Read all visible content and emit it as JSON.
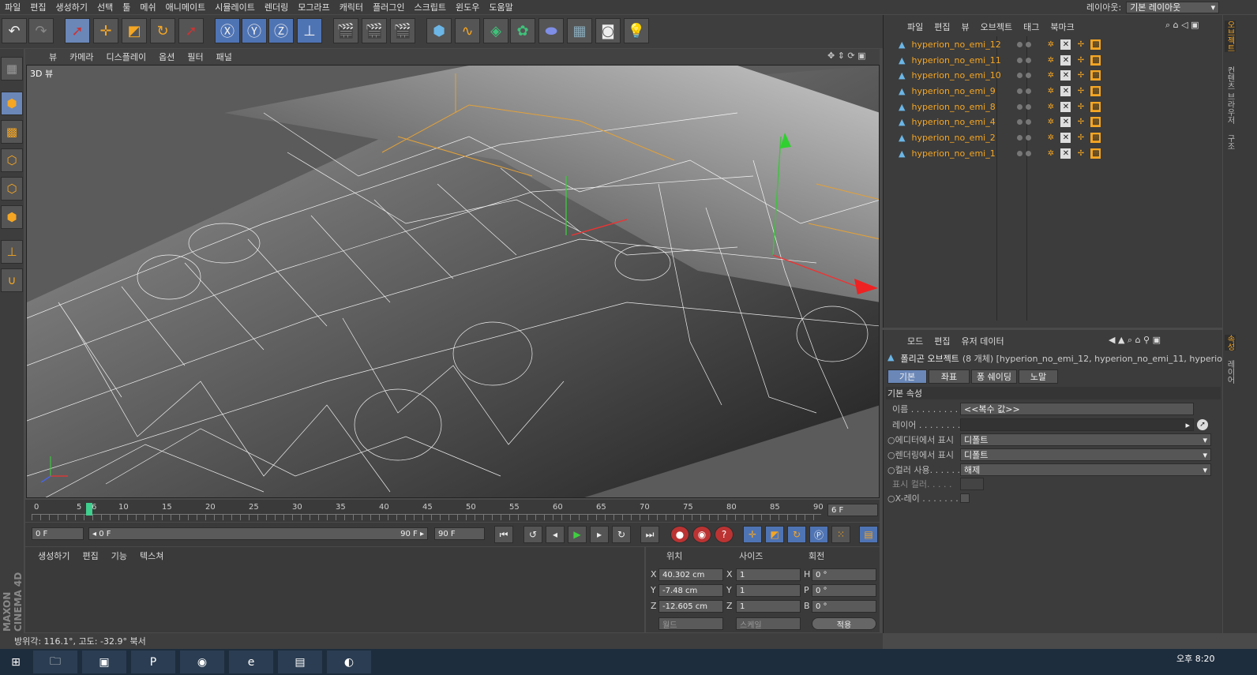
{
  "menubar": {
    "items": [
      "파일",
      "편집",
      "생성하기",
      "선택",
      "툴",
      "메쉬",
      "애니메이트",
      "시뮬레이트",
      "렌더링",
      "모그라프",
      "캐릭터",
      "플러그인",
      "스크립트",
      "윈도우",
      "도움말"
    ]
  },
  "layout": {
    "label": "레이아웃:",
    "value": "기본 레이아웃"
  },
  "viewport": {
    "menu": [
      "뷰",
      "카메라",
      "디스플레이",
      "옵션",
      "필터",
      "패널"
    ],
    "label": "3D 뷰"
  },
  "timeline": {
    "ticks": [
      "0",
      "5",
      "6",
      "10",
      "15",
      "20",
      "25",
      "30",
      "35",
      "40",
      "45",
      "50",
      "55",
      "60",
      "65",
      "70",
      "75",
      "80",
      "85",
      "90"
    ],
    "end_field": "6 F",
    "current_frame": 6,
    "max_frame": 90
  },
  "playbar": {
    "start": "0 F",
    "range_start": "◂ 0 F",
    "range_end": "90 F ▸",
    "end": "90 F"
  },
  "material": {
    "menu": [
      "생성하기",
      "편집",
      "기능",
      "텍스쳐"
    ]
  },
  "coords": {
    "headers": [
      "위치",
      "사이즈",
      "회전"
    ],
    "rows": [
      {
        "axis": "X",
        "pos": "40.302 cm",
        "size_axis": "X",
        "size": "1",
        "rot_axis": "H",
        "rot": "0 °"
      },
      {
        "axis": "Y",
        "pos": "-7.48 cm",
        "size_axis": "Y",
        "size": "1",
        "rot_axis": "P",
        "rot": "0 °"
      },
      {
        "axis": "Z",
        "pos": "-12.605 cm",
        "size_axis": "Z",
        "size": "1",
        "rot_axis": "B",
        "rot": "0 °"
      }
    ],
    "world": "월드",
    "scale": "스케일",
    "apply": "적용"
  },
  "status": {
    "text": "방위각: 116.1°, 고도: -32.9°  북서"
  },
  "objects": {
    "menu": [
      "파일",
      "편집",
      "뷰",
      "오브젝트",
      "태그",
      "북마크"
    ],
    "items": [
      "hyperion_no_emi_12",
      "hyperion_no_emi_11",
      "hyperion_no_emi_10",
      "hyperion_no_emi_9",
      "hyperion_no_emi_8",
      "hyperion_no_emi_4",
      "hyperion_no_emi_2",
      "hyperion_no_emi_1"
    ]
  },
  "attributes": {
    "menu": [
      "모드",
      "편집",
      "유저 데이터"
    ],
    "header": "폴리곤 오브젝트",
    "header_detail": "(8 개체) [hyperion_no_emi_12, hyperion_no_emi_11, hyperion_no",
    "tabs": [
      "기본",
      "좌표",
      "퐁 쉐이딩",
      "노말"
    ],
    "section": "기본 속성",
    "props": [
      {
        "label": "이름 . . . . . . . . . .",
        "value": "<<복수 값>>"
      },
      {
        "label": "레이어 . . . . . . . . .",
        "value": ""
      },
      {
        "label": "에디터에서 표시",
        "value": "디폴트"
      },
      {
        "label": "렌더링에서 표시",
        "value": "디폴트"
      },
      {
        "label": "컬러 사용. . . . . . .",
        "value": "해제"
      },
      {
        "label": "표시 컬러. . . . .",
        "value": ""
      },
      {
        "label": "X-레이 . . . . . . . . .",
        "value": ""
      }
    ]
  },
  "side_tabs": [
    "오브젝트",
    "컨텐츠 브라우저",
    "구조",
    "속성",
    "레이어"
  ],
  "branding": "MAXON CINEMA 4D",
  "clock": {
    "time": "오후 8:20"
  },
  "colors": {
    "accent": "#f5a623",
    "selected": "#6a87b8"
  }
}
